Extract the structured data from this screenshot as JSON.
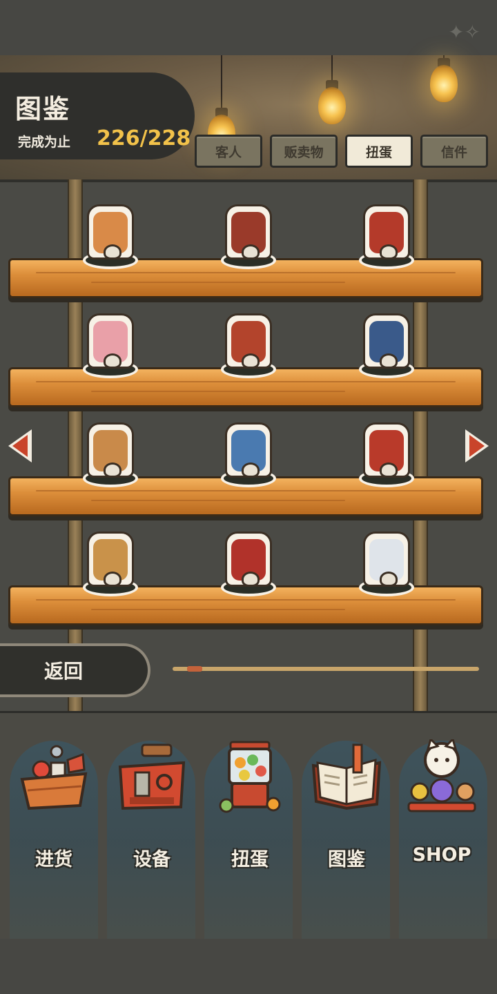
{
  "header": {
    "title": "图鉴",
    "progress_label": "完成为止",
    "progress_value": "226/228"
  },
  "tabs": [
    {
      "label": "客人",
      "active": false
    },
    {
      "label": "贩卖物",
      "active": false
    },
    {
      "label": "扭蛋",
      "active": true
    },
    {
      "label": "信件",
      "active": false
    }
  ],
  "collection": {
    "shelves": [
      {
        "items": [
          {
            "icon": "cat-with-pot-figure",
            "accent": "#d98a48"
          },
          {
            "icon": "cat-at-doorway-figure",
            "accent": "#9a3a2a"
          },
          {
            "icon": "cat-on-tv-figure",
            "accent": "#b43a2a"
          }
        ]
      },
      {
        "items": [
          {
            "icon": "cat-under-cherry-tree-figure",
            "accent": "#e9a0a8"
          },
          {
            "icon": "cat-on-mailbox-figure",
            "accent": "#b3442c"
          },
          {
            "icon": "cat-at-window-figure",
            "accent": "#3a5a8a"
          }
        ]
      },
      {
        "items": [
          {
            "icon": "cat-at-table-figure",
            "accent": "#c98a4a"
          },
          {
            "icon": "cat-with-lantern-figure",
            "accent": "#4a7ab0"
          },
          {
            "icon": "cat-at-shop-stall-figure",
            "accent": "#b93a2a"
          }
        ]
      },
      {
        "items": [
          {
            "icon": "cat-with-bucket-figure",
            "accent": "#c9924a"
          },
          {
            "icon": "cat-under-kotatsu-figure",
            "accent": "#b1322a"
          },
          {
            "icon": "cat-in-snow-figure",
            "accent": "#dfe4ea"
          }
        ]
      }
    ],
    "nav": {
      "prev_icon": "chevron-left-icon",
      "next_icon": "chevron-right-icon",
      "page_fraction": 0.05
    }
  },
  "back_label": "返回",
  "bottom_nav": [
    {
      "label": "进货",
      "icon": "supply-basket-icon"
    },
    {
      "label": "设备",
      "icon": "toolbox-icon"
    },
    {
      "label": "扭蛋",
      "icon": "gacha-machine-icon"
    },
    {
      "label": "图鉴",
      "icon": "catalog-book-icon"
    },
    {
      "label": "SHOP",
      "icon": "lucky-cat-icon"
    }
  ],
  "colors": {
    "accent_gold": "#f2c24a",
    "arrow_red": "#c9442a",
    "shelf_wood": "#dc8e3a"
  }
}
